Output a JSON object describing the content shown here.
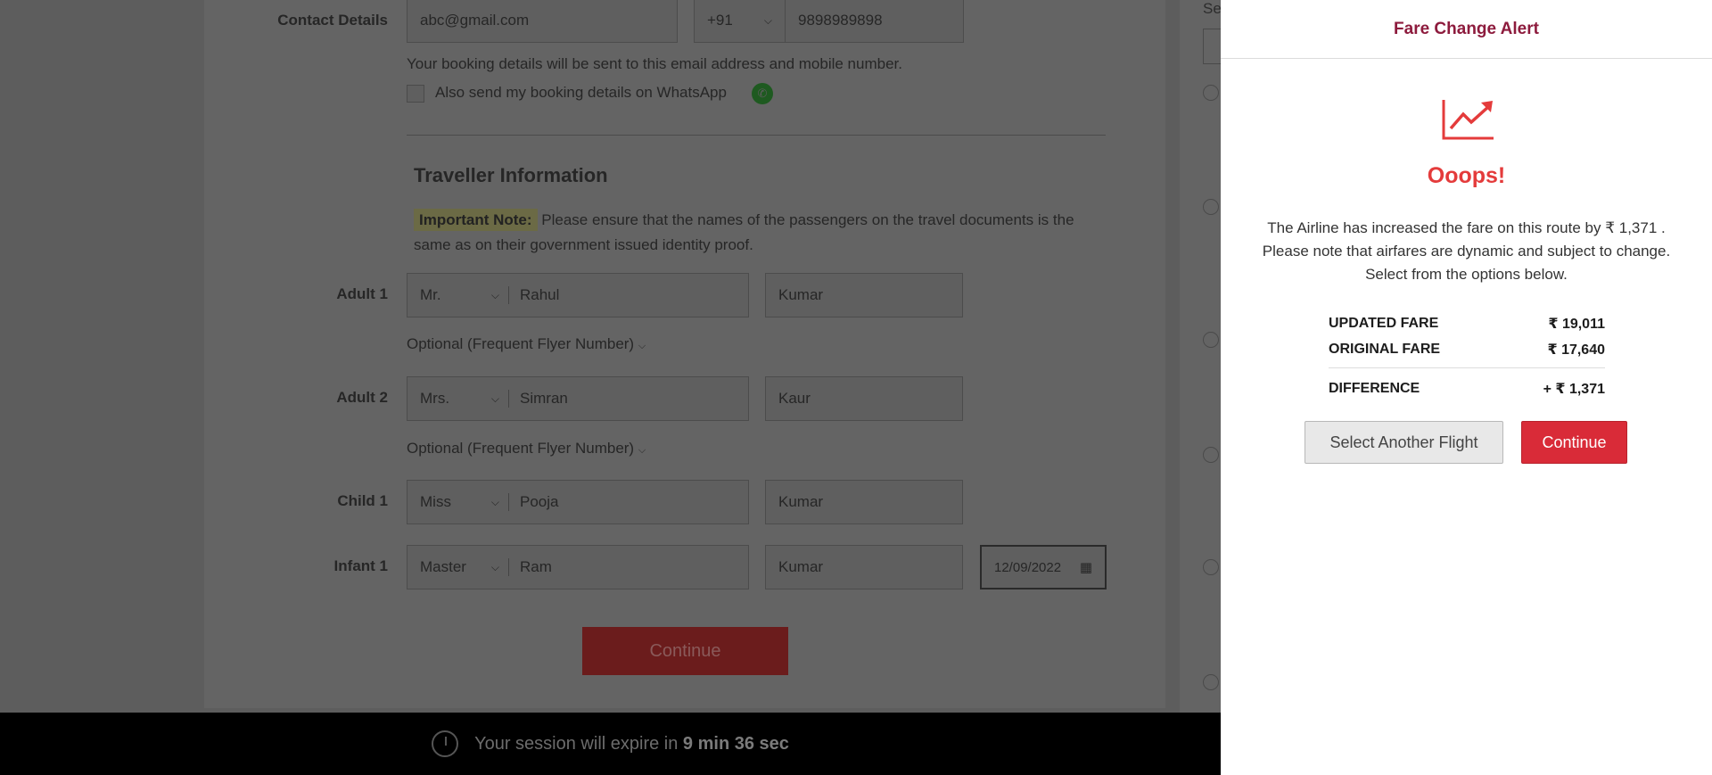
{
  "form": {
    "contact_label": "Contact Details",
    "email_value": "abc@gmail.com",
    "country_code": "+91",
    "mobile_value": "9898989898",
    "booking_note": "Your booking details will be sent to this email address and mobile number.",
    "whatsapp_label": "Also send my booking details on WhatsApp",
    "traveller_heading": "Traveller Information",
    "important_tag": "Important Note:",
    "important_text": "Please ensure that the names of the passengers on the travel documents is the same as on their government issued identity proof.",
    "optional_ffn": "Optional (Frequent Flyer Number)",
    "travellers": [
      {
        "label": "Adult 1",
        "title": "Mr.",
        "first": "Rahul",
        "last": "Kumar"
      },
      {
        "label": "Adult 2",
        "title": "Mrs.",
        "first": "Simran",
        "last": "Kaur"
      },
      {
        "label": "Child 1",
        "title": "Miss",
        "first": "Pooja",
        "last": "Kumar"
      },
      {
        "label": "Infant 1",
        "title": "Master",
        "first": "Ram",
        "last": "Kumar",
        "dob": "12/09/2022"
      }
    ],
    "continue_label": "Continue"
  },
  "side": {
    "select_label": "Se"
  },
  "session": {
    "prefix": "Your session will expire in",
    "time": "9 min 36 sec"
  },
  "modal": {
    "title": "Fare Change Alert",
    "oops": "Ooops!",
    "message_line1": "The Airline has increased the fare on this route by ₹ 1,371 .",
    "message_line2": "Please note that airfares are dynamic and subject to change.",
    "message_line3": "Select from the options below.",
    "updated_label": "UPDATED FARE",
    "updated_value": "₹ 19,011",
    "original_label": "ORIGINAL FARE",
    "original_value": "₹ 17,640",
    "difference_label": "DIFFERENCE",
    "difference_value": "+  ₹ 1,371",
    "select_another": "Select Another Flight",
    "continue": "Continue",
    "accent_color": "#d92b38",
    "title_color": "#8d1b3d"
  }
}
